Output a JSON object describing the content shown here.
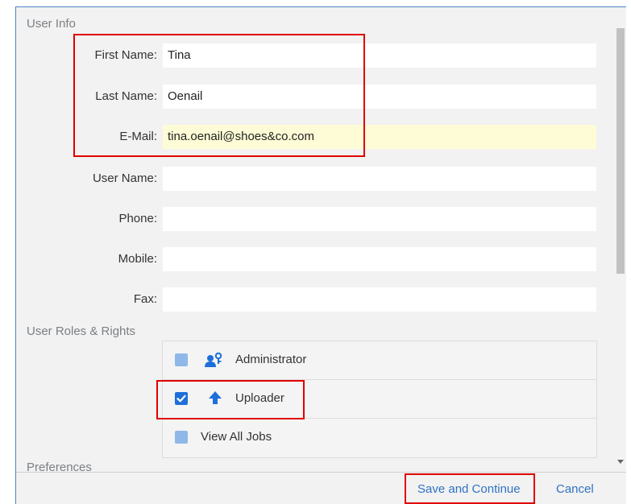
{
  "user_info": {
    "title": "User Info",
    "fields": [
      {
        "label": "First Name:",
        "value": "Tina"
      },
      {
        "label": "Last Name:",
        "value": "Oenail"
      },
      {
        "label": "E-Mail:",
        "value": "tina.oenail@shoes&co.com"
      },
      {
        "label": "User Name:",
        "value": ""
      },
      {
        "label": "Phone:",
        "value": ""
      },
      {
        "label": "Mobile:",
        "value": ""
      },
      {
        "label": "Fax:",
        "value": ""
      }
    ]
  },
  "roles": {
    "title": "User Roles & Rights",
    "items": [
      {
        "label": "Administrator",
        "checked": false,
        "icon": "administrator-icon"
      },
      {
        "label": "Uploader",
        "checked": true,
        "icon": "upload-arrow-icon"
      },
      {
        "label": "View All Jobs",
        "checked": false
      }
    ]
  },
  "preferences": {
    "title": "Preferences"
  },
  "footer": {
    "save_label": "Save and Continue",
    "cancel_label": "Cancel"
  },
  "colors": {
    "accent": "#2f73c2",
    "checkbox_checked": "#1e6fd9",
    "checkbox_unchecked": "#8fb8e8",
    "highlight_field": "#fefcd6",
    "annotation_red": "#e00000"
  }
}
